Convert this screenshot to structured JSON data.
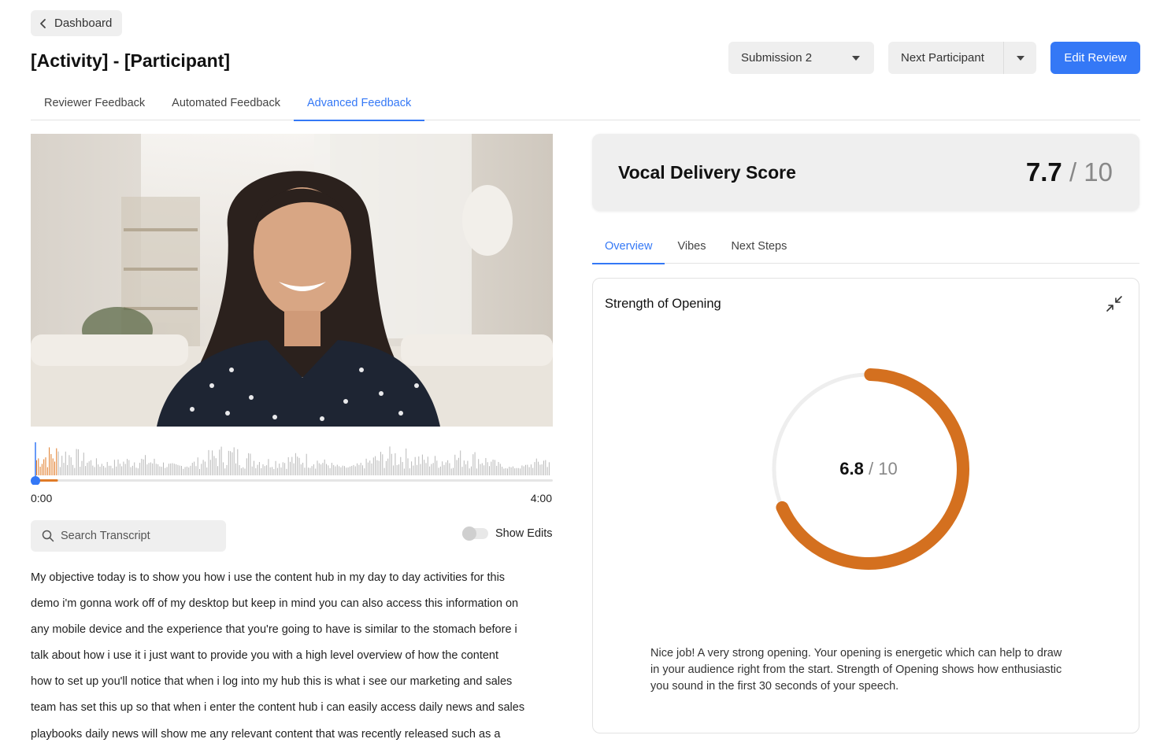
{
  "nav": {
    "back_label": "Dashboard"
  },
  "page": {
    "title": "[Activity] - [Participant]"
  },
  "header": {
    "submission_select": "Submission 2",
    "next_participant_label": "Next Participant",
    "edit_review_label": "Edit Review"
  },
  "tabs": [
    "Reviewer Feedback",
    "Automated Feedback",
    "Advanced Feedback"
  ],
  "active_tab": "Advanced Feedback",
  "player": {
    "time_start": "0:00",
    "time_end": "4:00",
    "progress": 0.01,
    "played_color": "#e07b27",
    "playhead_color": "#3478f6"
  },
  "search": {
    "placeholder": "Search Transcript"
  },
  "show_edits": {
    "label": "Show Edits",
    "on": false
  },
  "transcript_lines": [
    "My objective today is to show you how i use the content hub in my day to day activities for this",
    "demo i'm gonna work off of my desktop but keep in mind you can also access this information on",
    "any mobile device and the experience that you're going to have is similar to the stomach before i",
    "talk about how i use it i just want to provide you with a high level overview of how the content",
    "how to set up you'll notice that when i log into my hub this is what i see our marketing and sales",
    "team has set this up so that when i enter the content hub i can easily access daily news and sales",
    "playbooks daily news will show me any relevant content that was recently released such as a"
  ],
  "vocal_score": {
    "label": "Vocal Delivery Score",
    "value": "7.7",
    "max": " / 10"
  },
  "feedback_tabs": [
    "Overview",
    "Vibes",
    "Next Steps"
  ],
  "active_feedback_tab": "Overview",
  "opening": {
    "title": "Strength of Opening",
    "value": "6.8",
    "max": " / 10",
    "score": 6.8,
    "out_of": 10,
    "gauge_color": "#d4701f",
    "track_color": "#eeeeee",
    "description": "Nice job! A very strong opening. Your opening is energetic which can help to draw in your audience right from the start. Strength of Opening shows how enthusiastic you sound in the first 30 seconds of your speech."
  },
  "accent_color": "#3478f6"
}
